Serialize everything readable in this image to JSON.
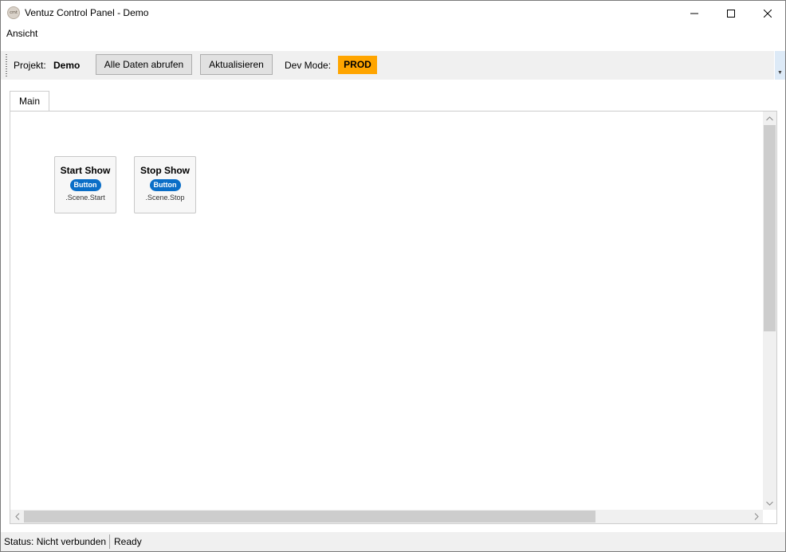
{
  "window": {
    "title": "Ventuz Control Panel - Demo",
    "icon_label": "cmt",
    "controls": [
      "minimize-icon",
      "maximize-icon",
      "close-icon"
    ]
  },
  "menu": {
    "items": [
      {
        "label": "Ansicht"
      }
    ]
  },
  "toolbar": {
    "project_label": "Projekt:",
    "project_value": "Demo",
    "fetch_all_label": "Alle Daten abrufen",
    "refresh_label": "Aktualisieren",
    "dev_mode_label": "Dev Mode:",
    "dev_mode_value": "PROD",
    "dev_mode_color": "#ffa500",
    "overflow_icon": "chevron-down-icon"
  },
  "tabs": [
    {
      "label": "Main",
      "active": true
    }
  ],
  "cards": [
    {
      "title": "Start Show",
      "type": "Button",
      "target": ".Scene.Start"
    },
    {
      "title": "Stop Show",
      "type": "Button",
      "target": ".Scene.Stop"
    }
  ],
  "colors": {
    "badge_blue": "#0a6ec7",
    "accent_orange": "#ffa500"
  },
  "statusbar": {
    "connection": "Status: Nicht verbunden",
    "state": "Ready"
  }
}
